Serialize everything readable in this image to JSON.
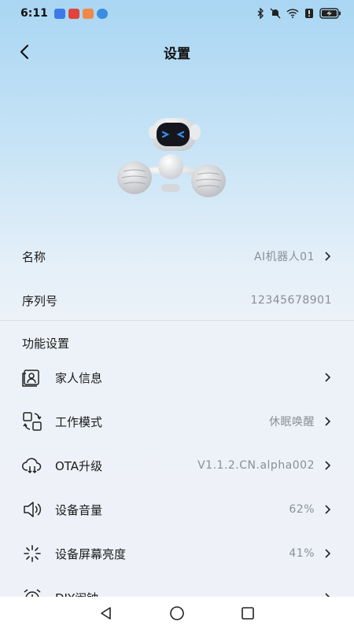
{
  "status_bar": {
    "time": "6:11"
  },
  "header": {
    "title": "设置"
  },
  "info": [
    {
      "label": "名称",
      "value": "AI机器人01"
    },
    {
      "label": "序列号",
      "value": "12345678901"
    }
  ],
  "function_section": {
    "title": "功能设置",
    "items": [
      {
        "label": "家人信息",
        "value": "",
        "icon": "family-info-icon"
      },
      {
        "label": "工作模式",
        "value": "休眠唤醒",
        "icon": "work-mode-icon"
      },
      {
        "label": "OTA升级",
        "value": "V1.1.2.CN.alpha002",
        "icon": "cloud-download-icon"
      },
      {
        "label": "设备音量",
        "value": "62%",
        "icon": "speaker-icon"
      },
      {
        "label": "设备屏幕亮度",
        "value": "41%",
        "icon": "brightness-icon"
      },
      {
        "label": "DIY闹钟",
        "value": "",
        "icon": "alarm-clock-icon"
      }
    ]
  },
  "colors": {
    "accent_text": "#1a1a1a",
    "secondary_text": "#8a8f96",
    "background_top": "#a9d6f3"
  }
}
